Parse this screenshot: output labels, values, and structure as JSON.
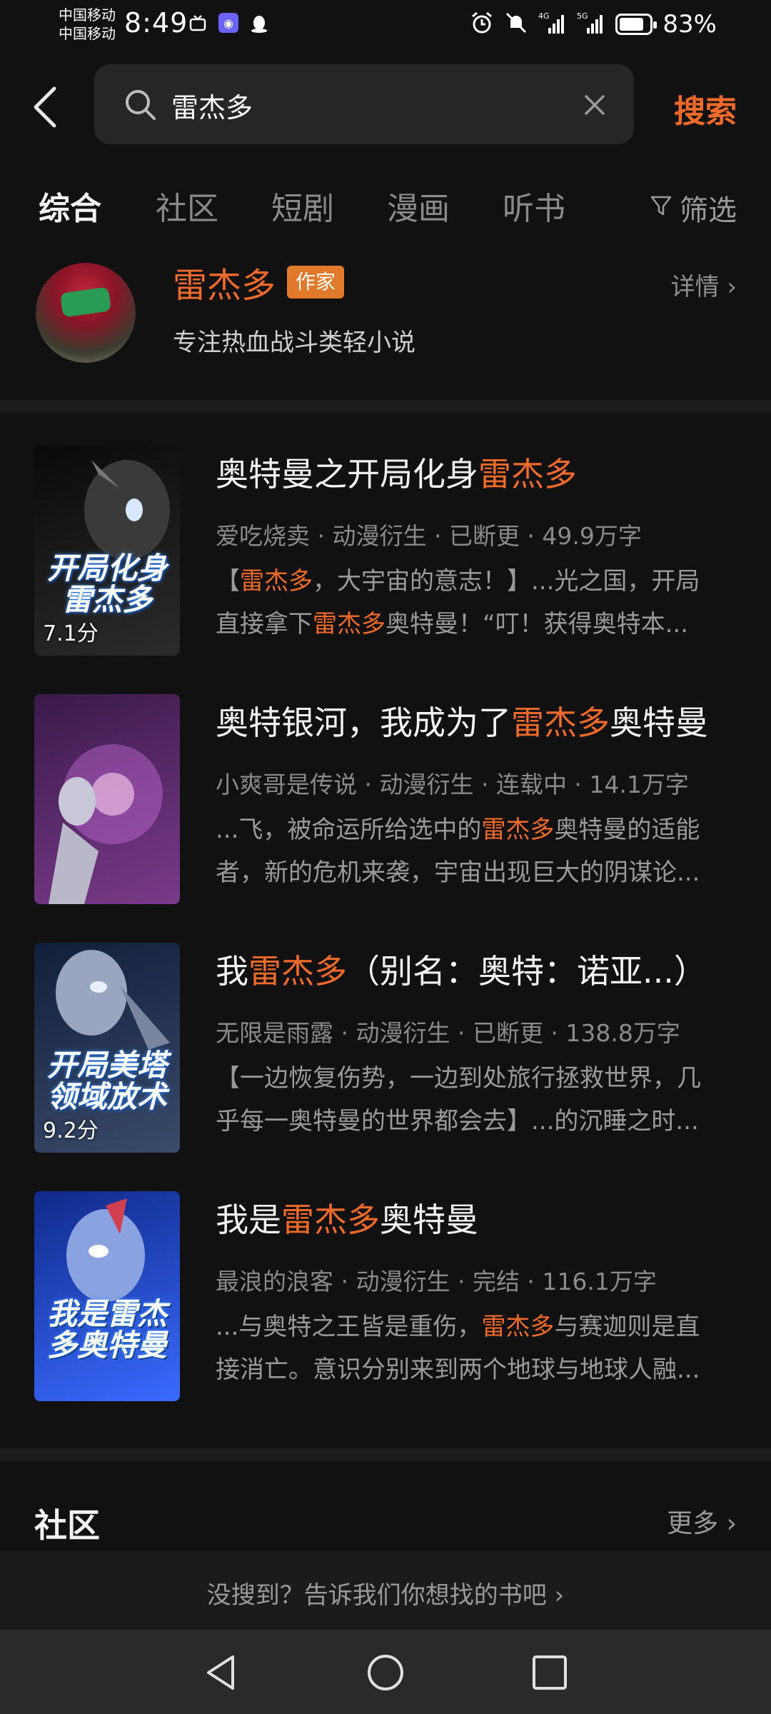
{
  "status_bar": {
    "carrier_1": "中国移动",
    "carrier_2": "中国移动",
    "time": "8:49",
    "network_1": "4G",
    "network_2": "5G",
    "battery": "83%",
    "battery_level": 0.83
  },
  "search": {
    "query": "雷杰多",
    "button": "搜索"
  },
  "tabs": [
    "综合",
    "社区",
    "短剧",
    "漫画",
    "听书"
  ],
  "filter_label": "筛选",
  "author": {
    "name": "雷杰多",
    "badge": "作家",
    "desc": "专注热血战斗类轻小说",
    "detail": "详情 ›"
  },
  "books": [
    {
      "title_pre": "奥特曼之开局化身",
      "title_hl": "雷杰多",
      "title_post": "",
      "meta": "爱吃烧卖 · 动漫衍生 · 已断更 · 49.9万字",
      "snippet_1_pre": "【",
      "snippet_1_hl": "雷杰多",
      "snippet_1_post": "，大宇宙的意志！】...光之国，开局",
      "snippet_2_pre": "直接拿下",
      "snippet_2_hl": "雷杰多",
      "snippet_2_post": "奥特曼！“叮！获得奥特本...",
      "cover_text": "开局化身雷杰多",
      "rating": "7.1分",
      "cover_colors": [
        "#0a0a0a",
        "#2b2b2b"
      ]
    },
    {
      "title_pre": "奥特银河，我成为了",
      "title_hl": "雷杰多",
      "title_post": "奥特曼",
      "meta": "小爽哥是传说 · 动漫衍生 · 连载中 · 14.1万字",
      "snippet_1_pre": "...飞，被命运所给选中的",
      "snippet_1_hl": "雷杰多",
      "snippet_1_post": "奥特曼的适能",
      "snippet_2_pre": "者，新的危机来袭，宇宙出现巨大的阴谋论...",
      "snippet_2_hl": "",
      "snippet_2_post": "",
      "cover_text": "",
      "rating": "",
      "cover_colors": [
        "#3a1a4a",
        "#7a3a8a"
      ]
    },
    {
      "title_pre": "我",
      "title_hl": "雷杰多",
      "title_post": "（别名：奥特：诺亚...）",
      "meta": "无限是雨露 · 动漫衍生 · 已断更 · 138.8万字",
      "snippet_1_pre": "【一边恢复伤势，一边到处旅行拯救世界，几",
      "snippet_1_hl": "",
      "snippet_1_post": "",
      "snippet_2_pre": "乎每一奥特曼的世界都会去】...的沉睡之时...",
      "snippet_2_hl": "",
      "snippet_2_post": "",
      "cover_text": "开局美塔领域放术",
      "rating": "9.2分",
      "cover_colors": [
        "#10203a",
        "#3a4a6a"
      ]
    },
    {
      "title_pre": "我是",
      "title_hl": "雷杰多",
      "title_post": "奥特曼",
      "meta": "最浪的浪客 · 动漫衍生 · 完结 · 116.1万字",
      "snippet_1_pre": "...与奥特之王皆是重伤，",
      "snippet_1_hl": "雷杰多",
      "snippet_1_post": "与赛迦则是直",
      "snippet_2_pre": "接消亡。意识分别来到两个地球与地球人融...",
      "snippet_2_hl": "",
      "snippet_2_post": "",
      "cover_text": "我是雷杰多奥特曼",
      "rating": "",
      "cover_colors": [
        "#102a8a",
        "#3a6aff"
      ]
    }
  ],
  "community": {
    "title": "社区",
    "more": "更多 ›"
  },
  "feedback": "没搜到？告诉我们你想找的书吧  ›",
  "nav": [
    "back-nav",
    "home-nav",
    "recent-nav"
  ]
}
